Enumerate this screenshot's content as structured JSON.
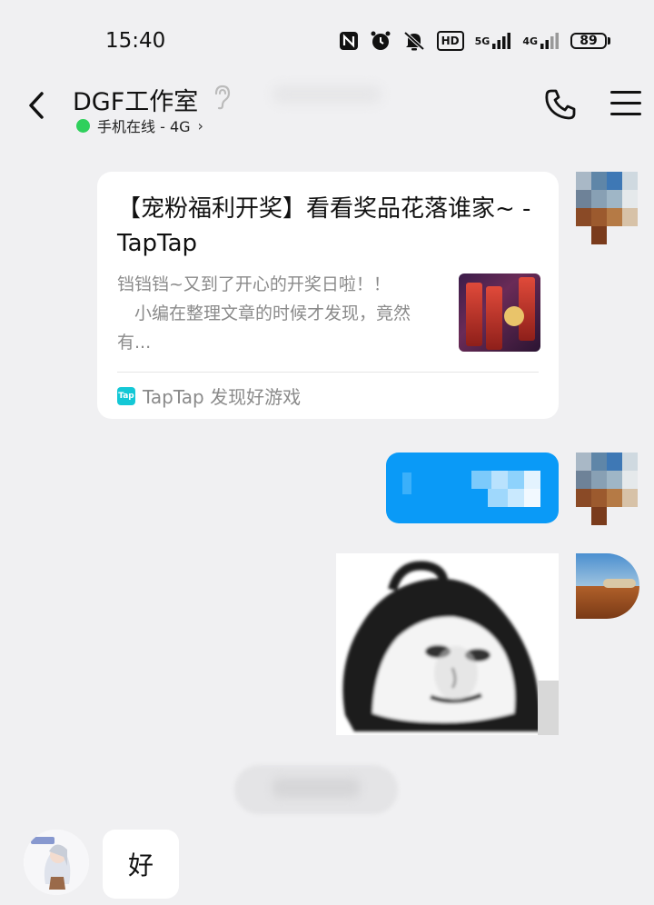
{
  "status_bar": {
    "time": "15:40",
    "icons": [
      "nfc-icon",
      "alarm-icon",
      "mute-icon",
      "hd-icon",
      "signal-5g-icon",
      "signal-4g-icon"
    ],
    "hd_label": "HD",
    "net1_label": "5G",
    "net2_label": "4G",
    "battery": "89"
  },
  "header": {
    "title": "DGF工作室",
    "status_text": "手机在线 - 4G",
    "status_chevron": "›",
    "online_color": "#2fd05c"
  },
  "messages": {
    "link_card": {
      "title": "【宠粉福利开奖】看看奖品花落谁家~ - TapTap",
      "description": "铛铛铛~又到了开心的开奖日啦！！\n　小编在整理文章的时候才发现，竟然有...",
      "source_icon": "Tap",
      "source": "TapTap 发现好游戏"
    },
    "incoming_text": "好"
  },
  "colors": {
    "bubble_blue": "#0a9af7",
    "background": "#f0f0f2"
  }
}
